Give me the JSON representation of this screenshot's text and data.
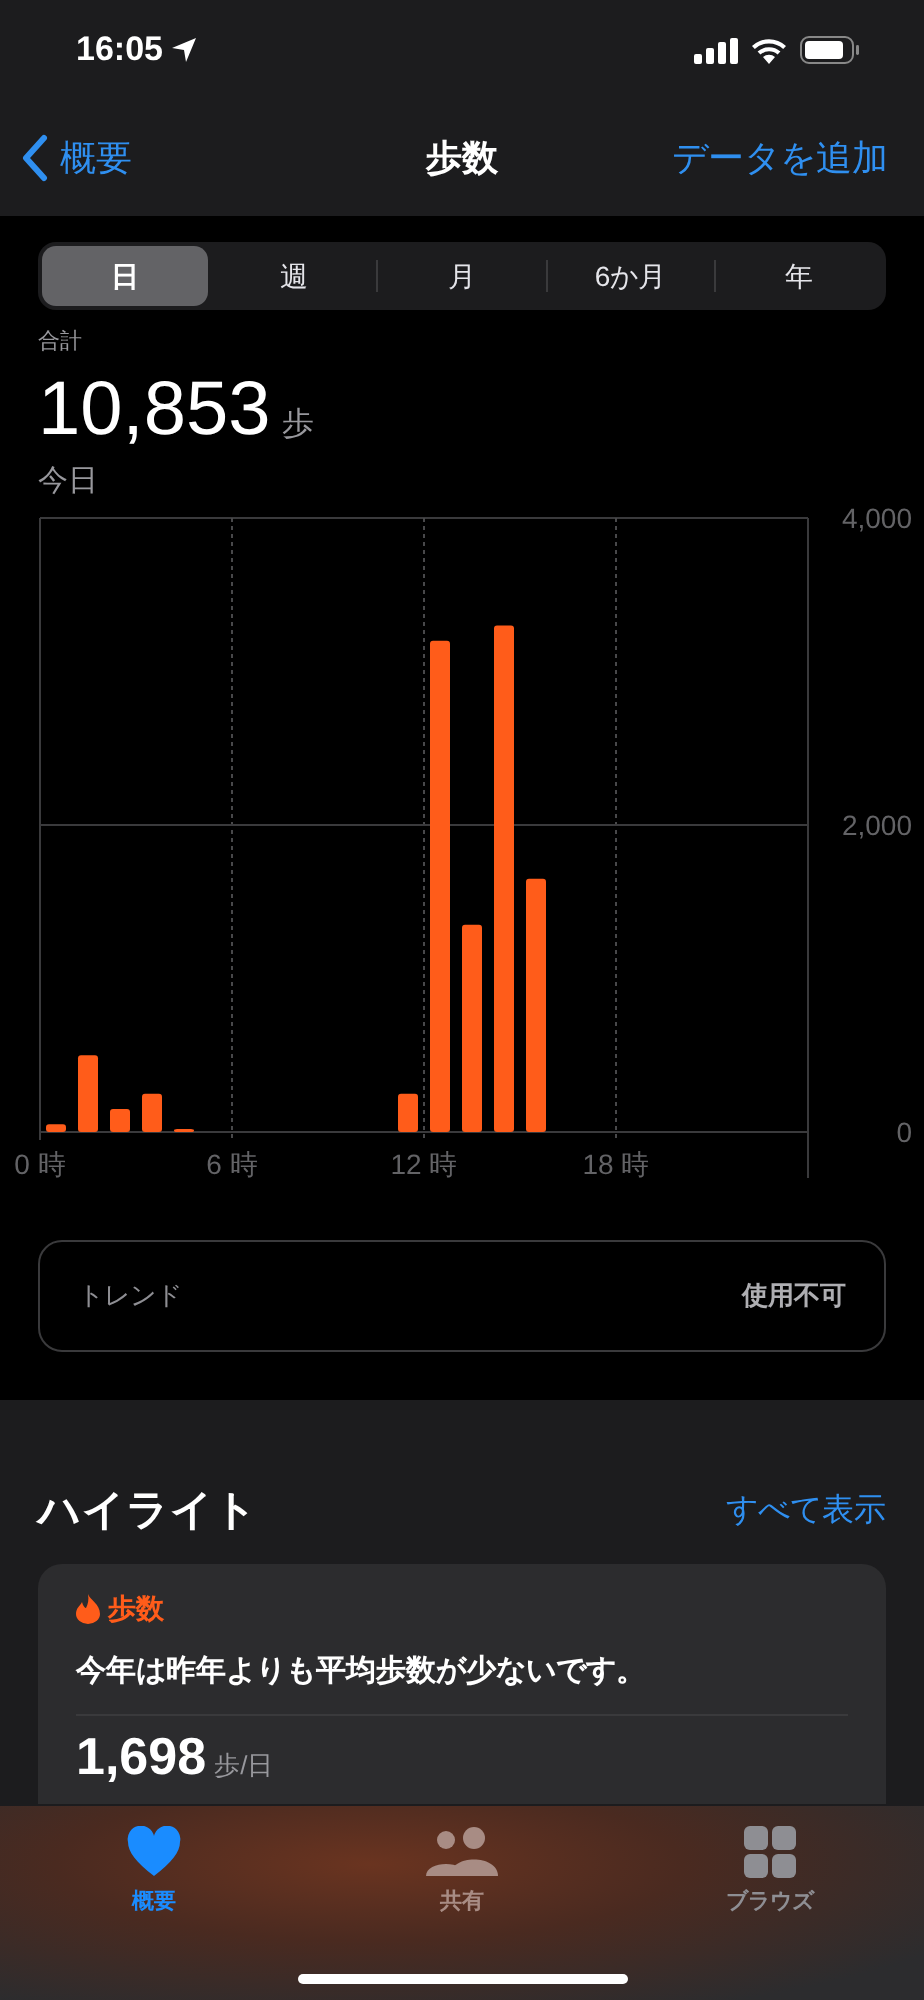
{
  "status_bar": {
    "time": "16:05"
  },
  "nav": {
    "back": "概要",
    "title": "歩数",
    "action": "データを追加"
  },
  "tabs": [
    {
      "label": "日",
      "selected": true
    },
    {
      "label": "週",
      "selected": false
    },
    {
      "label": "月",
      "selected": false
    },
    {
      "label": "6か月",
      "selected": false
    },
    {
      "label": "年",
      "selected": false
    }
  ],
  "summary": {
    "label": "合計",
    "value": "10,853",
    "unit": "歩",
    "date": "今日"
  },
  "chart_data": {
    "type": "bar",
    "x": [
      0.5,
      1.5,
      2.5,
      3.5,
      4.5,
      5.5,
      6.5,
      7.5,
      8.5,
      9.5,
      10.5,
      11.5,
      12.5,
      13.5,
      14.5,
      15.5,
      16.5,
      17.5,
      18.5,
      19.5,
      20.5,
      21.5,
      22.5,
      23.5
    ],
    "series": [
      {
        "color": "#ff5c1a",
        "values": [
          50,
          500,
          150,
          250,
          20,
          0,
          0,
          0,
          0,
          0,
          0,
          250,
          3200,
          1350,
          3300,
          1650,
          0,
          0,
          0,
          0,
          0,
          0,
          0,
          0
        ]
      }
    ],
    "xlim": [
      0,
      24
    ],
    "grid": true,
    "ref_lines": [
      {
        "axis": "y",
        "value": 2000
      }
    ],
    "ylim": [
      0,
      4000
    ],
    "yticks": [
      {
        "value": 0,
        "label": "0"
      },
      {
        "value": 2000,
        "label": "2,000"
      },
      {
        "value": 4000,
        "label": "4,000"
      }
    ],
    "xticks": [
      {
        "value": 0,
        "label": "0 時"
      },
      {
        "value": 6,
        "label": "6 時"
      },
      {
        "value": 12,
        "label": "12 時"
      },
      {
        "value": 18,
        "label": "18 時"
      }
    ]
  },
  "trend": {
    "label": "トレンド",
    "value": "使用不可"
  },
  "highlights": {
    "title": "ハイライト",
    "link": "すべて表示",
    "card": {
      "category": "歩数",
      "text": "今年は昨年よりも平均歩数が少ないです。",
      "value": "1,698",
      "unit": "歩/日"
    }
  },
  "tab_bar": [
    {
      "label": "概要",
      "selected": true
    },
    {
      "label": "共有",
      "selected": false
    },
    {
      "label": "ブラウズ",
      "selected": false
    }
  ]
}
